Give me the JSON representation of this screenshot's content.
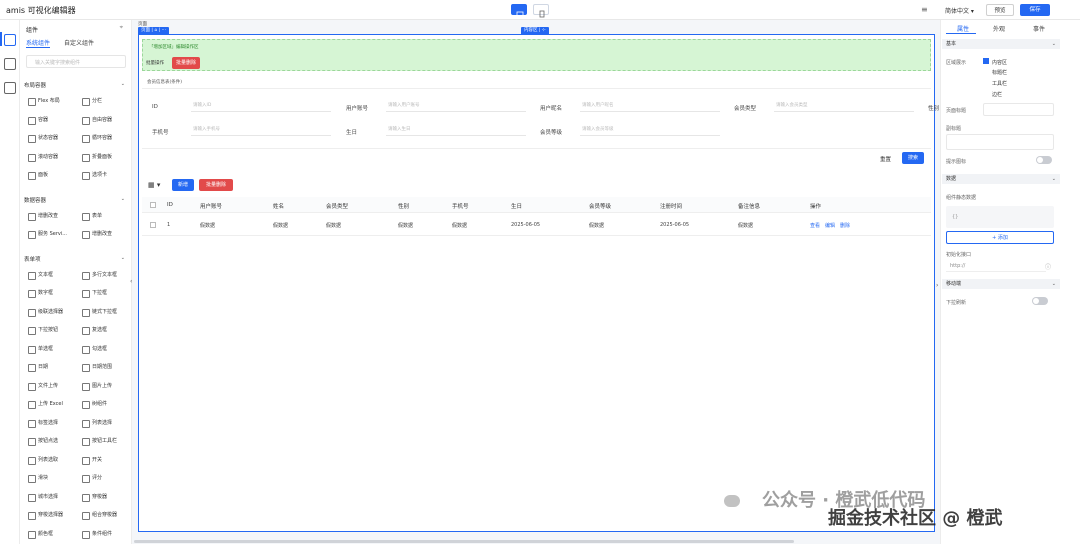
{
  "topbar": {
    "title": "amis 可视化编辑器",
    "language": "简体中文",
    "preview_label": "预览",
    "save_label": "保存"
  },
  "components_panel": {
    "title": "组件",
    "tabs": [
      "系统组件",
      "自定义组件"
    ],
    "search_placeholder": "输入关键字搜索组件",
    "sections": [
      {
        "title": "布局容器",
        "items": [
          "Flex 布局",
          "分栏",
          "容器",
          "自由容器",
          "状态容器",
          "循环容器",
          "滚动容器",
          "折叠面板",
          "面板",
          "选项卡"
        ]
      },
      {
        "title": "数据容器",
        "items": [
          "增删改查",
          "表单",
          "服务 Servi...",
          "增删改查"
        ]
      },
      {
        "title": "表单项",
        "items": [
          "文本框",
          "多行文本框",
          "数字框",
          "下拉框",
          "级联选择器",
          "链式下拉框",
          "下拉按钮",
          "复选框",
          "单选框",
          "勾选框",
          "日期",
          "日期范围",
          "文件上传",
          "图片上传",
          "上传 Excel",
          "树组件",
          "标签选择",
          "列表选择",
          "按钮点选",
          "按钮工具栏",
          "列表选取",
          "开关",
          "滑块",
          "评分",
          "城市选择",
          "穿梭器",
          "穿梭选择器",
          "组合穿梭器",
          "颜色框",
          "条件组件"
        ]
      }
    ]
  },
  "canvas": {
    "page_chip": "页面",
    "region_chip": "内容区",
    "toolbar_hint": "「增加区域」编辑操作区",
    "batch_ops_label": "批量操作",
    "batch_delete_label": "批量删除",
    "search_form_title": "会员信息表(条件)",
    "filters": [
      {
        "label": "ID",
        "placeholder": "请输入ID"
      },
      {
        "label": "用户账号",
        "placeholder": "请输入用户账号"
      },
      {
        "label": "用户昵名",
        "placeholder": "请输入用户昵名"
      },
      {
        "label": "会员类型",
        "placeholder": "请输入会员类型"
      },
      {
        "label": "手机号",
        "placeholder": "请输入手机号"
      },
      {
        "label": "生日",
        "placeholder": "请输入生日"
      },
      {
        "label": "会员等级",
        "placeholder": "请输入会员等级"
      },
      {
        "label": "性别",
        "placeholder": ""
      }
    ],
    "reset_label": "重置",
    "search_label": "搜索",
    "add_label": "新增",
    "bulk_delete_label": "批量删除",
    "columns": [
      "ID",
      "用户账号",
      "姓名",
      "会员类型",
      "性别",
      "手机号",
      "生日",
      "会员等级",
      "注册时间",
      "备注信息",
      "操作"
    ],
    "rows": [
      [
        "1",
        "假数据",
        "假数据",
        "假数据",
        "假数据",
        "假数据",
        "2025-06-05",
        "假数据",
        "2025-06-05",
        "假数据"
      ]
    ],
    "row_actions": [
      "查看",
      "编辑",
      "删除"
    ]
  },
  "props_panel": {
    "tabs": [
      "属性",
      "外观",
      "事件"
    ],
    "groups": [
      "基本",
      "数据",
      "移动端"
    ],
    "region_label": "区域展示",
    "region_options": [
      {
        "label": "内容区",
        "checked": true
      },
      {
        "label": "标题栏",
        "checked": false
      },
      {
        "label": "工具栏",
        "checked": false
      },
      {
        "label": "边栏",
        "checked": false
      }
    ],
    "page_title_label": "页面标题",
    "subtitle_label": "副标题",
    "tooltip_label": "提示图标",
    "data_label": "组件静态数据",
    "data_placeholder": "{}",
    "add_field_label": "+ 添加",
    "init_api_label": "初始化接口",
    "init_api_placeholder": "http://",
    "pull_refresh_label": "下拉刷新"
  },
  "watermark": {
    "line1": "公众号 · 橙武低代码",
    "line2": "掘金技术社区 @ 橙武"
  },
  "colors": {
    "accent": "#2468f2",
    "danger": "#e24a4a",
    "zone": "#d6f5d4"
  }
}
